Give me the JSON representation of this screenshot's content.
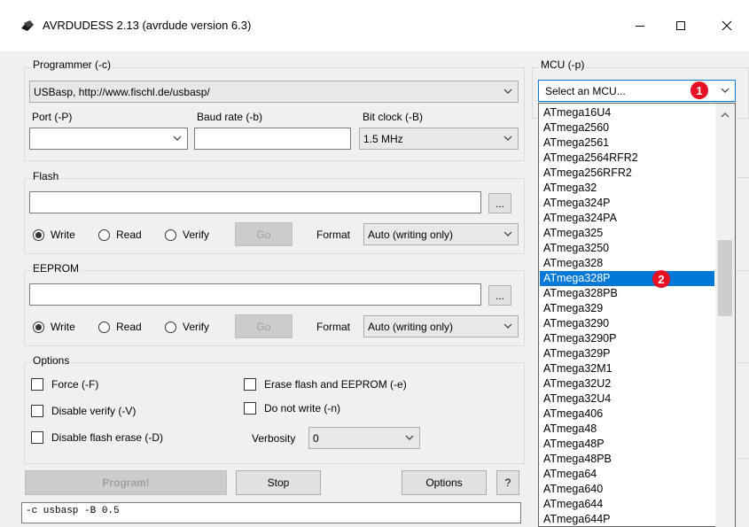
{
  "window": {
    "title": "AVRDUDESS 2.13 (avrdude version 6.3)",
    "minimize_icon": "minimize-icon",
    "maximize_icon": "maximize-icon",
    "close_icon": "close-icon"
  },
  "programmer": {
    "group_label": "Programmer (-c)",
    "selected": "USBasp, http://www.fischl.de/usbasp/",
    "port_label": "Port (-P)",
    "port_value": "",
    "baud_label": "Baud rate (-b)",
    "baud_value": "",
    "bitclock_label": "Bit clock (-B)",
    "bitclock_value": "1.5 MHz"
  },
  "flash": {
    "group_label": "Flash",
    "path": "",
    "browse_label": "...",
    "write_label": "Write",
    "read_label": "Read",
    "verify_label": "Verify",
    "go_label": "Go",
    "format_label": "Format",
    "format_value": "Auto (writing only)",
    "selected_mode": "write"
  },
  "eeprom": {
    "group_label": "EEPROM",
    "path": "",
    "browse_label": "...",
    "write_label": "Write",
    "read_label": "Read",
    "verify_label": "Verify",
    "go_label": "Go",
    "format_label": "Format",
    "format_value": "Auto (writing only)",
    "selected_mode": "write"
  },
  "options": {
    "group_label": "Options",
    "force_label": "Force (-F)",
    "disable_verify_label": "Disable verify (-V)",
    "disable_flash_erase_label": "Disable flash erase (-D)",
    "erase_label": "Erase flash and EEPROM (-e)",
    "do_not_write_label": "Do not write (-n)",
    "verbosity_label": "Verbosity",
    "verbosity_value": "0"
  },
  "actions": {
    "program_label": "Program!",
    "stop_label": "Stop",
    "options_label": "Options",
    "help_label": "?"
  },
  "command_line": "-c usbasp -B 0.5",
  "mcu": {
    "group_label": "MCU (-p)",
    "selected": "Select an MCU...",
    "items": [
      "ATmega16U4",
      "ATmega2560",
      "ATmega2561",
      "ATmega2564RFR2",
      "ATmega256RFR2",
      "ATmega32",
      "ATmega324P",
      "ATmega324PA",
      "ATmega325",
      "ATmega3250",
      "ATmega328",
      "ATmega328P",
      "ATmega328PB",
      "ATmega329",
      "ATmega3290",
      "ATmega3290P",
      "ATmega329P",
      "ATmega32M1",
      "ATmega32U2",
      "ATmega32U4",
      "ATmega406",
      "ATmega48",
      "ATmega48P",
      "ATmega48PB",
      "ATmega64",
      "ATmega640",
      "ATmega644",
      "ATmega644P"
    ],
    "highlighted_item": "ATmega328P",
    "scroll_position": 0.32
  },
  "annotations": {
    "badge1": "1",
    "badge2": "2"
  },
  "colors": {
    "accent": "#0078d7",
    "badge": "#e81123"
  }
}
